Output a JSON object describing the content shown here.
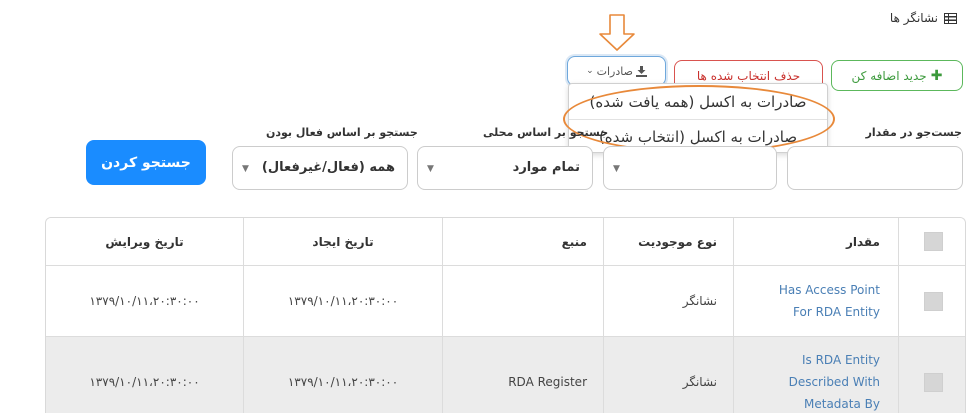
{
  "page": {
    "title": "نشانگر ها",
    "icon": "list-icon"
  },
  "toolbar": {
    "add_label": "جدید اضافه کن",
    "add_icon": "plus-icon",
    "delete_label": "حذف انتخاب شده ها",
    "export_label": "صادرات",
    "export_icon": "download-icon",
    "export_caret": "⌄"
  },
  "export_menu": {
    "items": [
      {
        "label": "صادرات به اکسل (همه یافت شده)"
      },
      {
        "label": "صادرات به اکسل (انتخاب شده)"
      }
    ]
  },
  "annotation": {
    "arrow_color": "#e8893a",
    "oval_color": "#e8893a"
  },
  "filters": {
    "value_label": "جست‌جو در مقدار",
    "location_label": "جستجو بر اساس محلی",
    "location_value": "تمام موارد",
    "active_label": "جستجو بر اساس فعال بودن",
    "active_value": "همه (فعال/غیرفعال)",
    "search_button": "جستجو کردن"
  },
  "table": {
    "headers": {
      "value": "مقدار",
      "entity_type": "نوع موجودیت",
      "source": "منبع",
      "created": "تاریخ ایجاد",
      "edited": "تاریخ ویرایش"
    },
    "rows": [
      {
        "value_lines": [
          "Has Access Point",
          "For RDA Entity"
        ],
        "entity_type": "نشانگر",
        "source": "",
        "created": "۱۳۷۹/۱۰/۱۱،۲۰:۳۰:۰۰",
        "edited": "۱۳۷۹/۱۰/۱۱،۲۰:۳۰:۰۰"
      },
      {
        "value_lines": [
          "Is RDA Entity",
          "Described With",
          "Metadata By"
        ],
        "entity_type": "نشانگر",
        "source": "RDA Register",
        "created": "۱۳۷۹/۱۰/۱۱،۲۰:۳۰:۰۰",
        "edited": "۱۳۷۹/۱۰/۱۱،۲۰:۳۰:۰۰"
      }
    ]
  },
  "colors": {
    "primary": "#1a8cff",
    "success": "#5cb85c",
    "danger": "#d9534f",
    "link": "#4a7fb5",
    "highlight": "#e8893a"
  }
}
